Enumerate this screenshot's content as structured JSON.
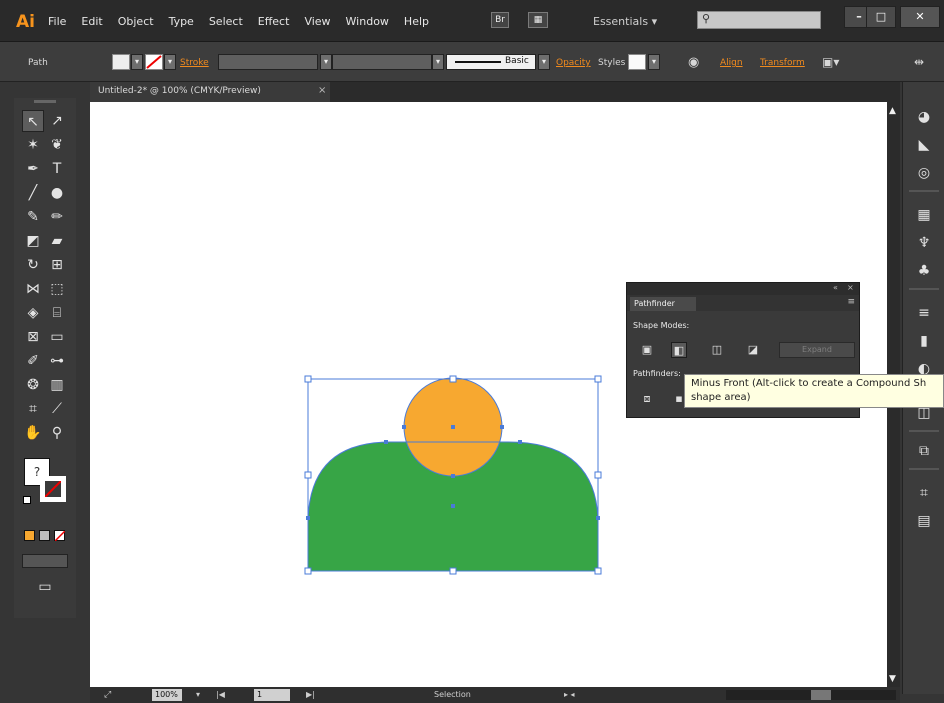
{
  "app": {
    "logo": "Ai",
    "menu": [
      "File",
      "Edit",
      "Object",
      "Type",
      "Select",
      "Effect",
      "View",
      "Window",
      "Help"
    ],
    "workspace": "Essentials",
    "workspace_arrow": "▾",
    "search_placeholder": "",
    "win_min": "–",
    "win_max": "□",
    "win_close": "✕"
  },
  "control_bar": {
    "selection_label": "Path",
    "stroke_label": "Stroke",
    "basic_label": "Basic",
    "opacity_label": "Opacity",
    "styles_label": "Styles",
    "align_label": "Align",
    "transform_label": "Transform"
  },
  "document": {
    "tab_title": "Untitled-2* @ 100% (CMYK/Preview)",
    "tab_close": "×"
  },
  "pathfinder": {
    "tab_label": "Pathfinder",
    "shape_modes_label": "Shape Modes:",
    "pathfinders_label": "Pathfinders:",
    "expand_label": "Expand",
    "collapse_glyph": "«",
    "close_glyph": "×",
    "menu_glyph": "≡"
  },
  "tooltip": {
    "line1": "Minus Front (Alt-click to create a Compound Sh",
    "line2": "shape area)"
  },
  "status_bar": {
    "zoom_value": "100%",
    "page_value": "1",
    "tool_label": "Selection",
    "nav_prev": "|◀",
    "nav_next": "▶|"
  },
  "canvas_shapes": {
    "colors": {
      "green": "#37a546",
      "orange": "#f7a830",
      "selection": "#4a7bd8"
    }
  }
}
